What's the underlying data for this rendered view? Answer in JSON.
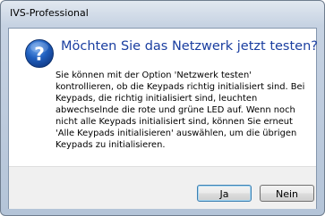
{
  "window": {
    "title": "IVS-Professional"
  },
  "dialog": {
    "icon": "question-icon",
    "heading": "Möchten Sie das Netzwerk jetzt testen?",
    "message_lines": [
      "Sie können mit der Option 'Netzwerk testen'",
      "kontrollieren, ob die Keypads richtig initialisiert sind. Bei",
      "Keypads, die richtig initialisiert sind, leuchten",
      "abwechselnde die rote und grüne LED auf. Wenn noch",
      "nicht alle Keypads initialisiert sind, können Sie erneut",
      "'Alle Keypads initialisieren' auswählen, um die übrigen",
      "Keypads zu initialisieren."
    ]
  },
  "buttons": {
    "yes_label": "Ja",
    "no_label": "Nein"
  },
  "colors": {
    "heading": "#1a3ea0",
    "icon_fill": "#1f5fbf",
    "default_button_border": "#3c7fb1"
  }
}
